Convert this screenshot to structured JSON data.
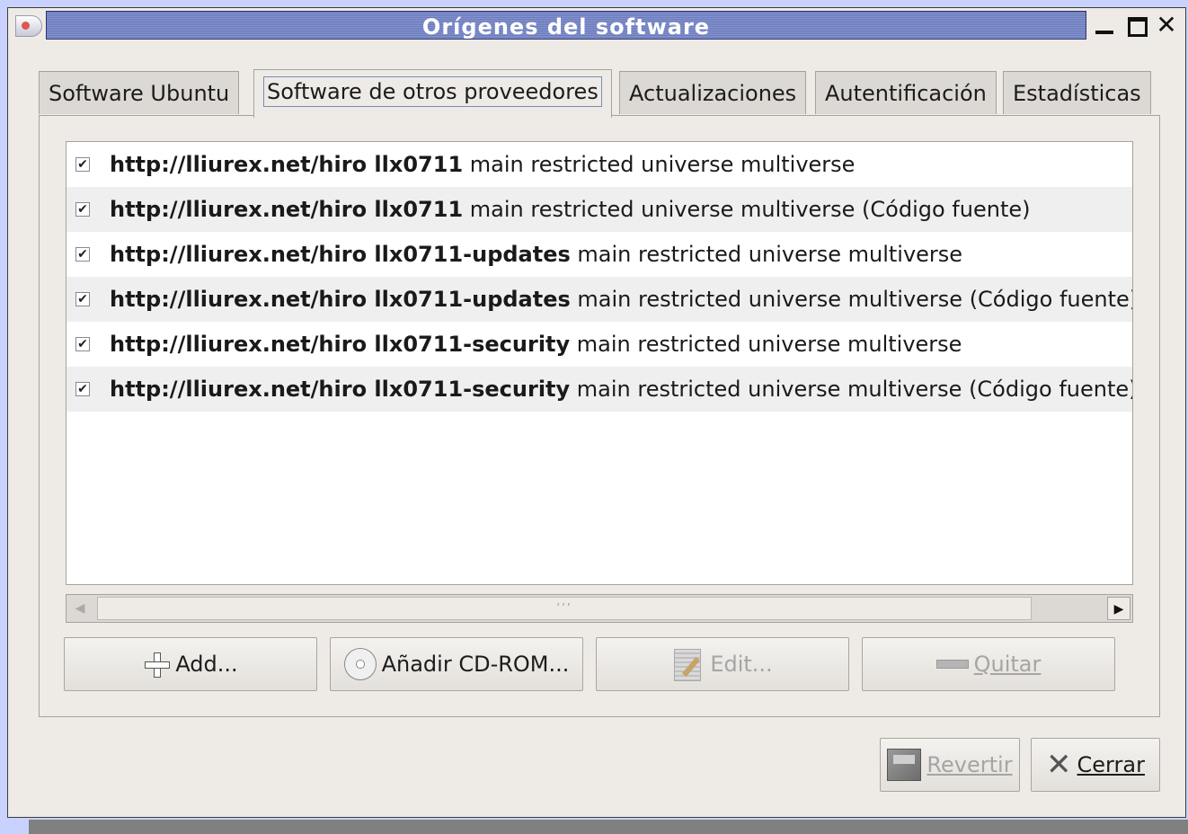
{
  "window": {
    "title": "Orígenes del software"
  },
  "tabs": [
    {
      "label": "Software Ubuntu"
    },
    {
      "label": "Software de otros proveedores"
    },
    {
      "label": "Actualizaciones"
    },
    {
      "label": "Autentificación"
    },
    {
      "label": "Estadísticas"
    }
  ],
  "sources": [
    {
      "checked": true,
      "url": "http://lliurex.net/hiro llx0711",
      "components": " main restricted universe multiverse"
    },
    {
      "checked": true,
      "url": "http://lliurex.net/hiro llx0711",
      "components": " main restricted universe multiverse (Código fuente)"
    },
    {
      "checked": true,
      "url": "http://lliurex.net/hiro llx0711-updates",
      "components": " main restricted universe multiverse"
    },
    {
      "checked": true,
      "url": "http://lliurex.net/hiro llx0711-updates",
      "components": " main restricted universe multiverse (Código fuente)"
    },
    {
      "checked": true,
      "url": "http://lliurex.net/hiro llx0711-security",
      "components": " main restricted universe multiverse"
    },
    {
      "checked": true,
      "url": "http://lliurex.net/hiro llx0711-security",
      "components": " main restricted universe multiverse (Código fuente)"
    }
  ],
  "buttons": {
    "add": "Add...",
    "add_cdrom": "Añadir CD-ROM...",
    "edit": "Edit...",
    "remove": "Quitar",
    "revert": "Revertir",
    "close": "Cerrar"
  },
  "checkbox_mark": "✔",
  "icons": {
    "add": "plus-icon",
    "cdrom": "cdrom-icon",
    "edit": "edit-document-icon",
    "remove": "minus-icon",
    "revert": "revert-icon",
    "close": "close-x-icon"
  }
}
